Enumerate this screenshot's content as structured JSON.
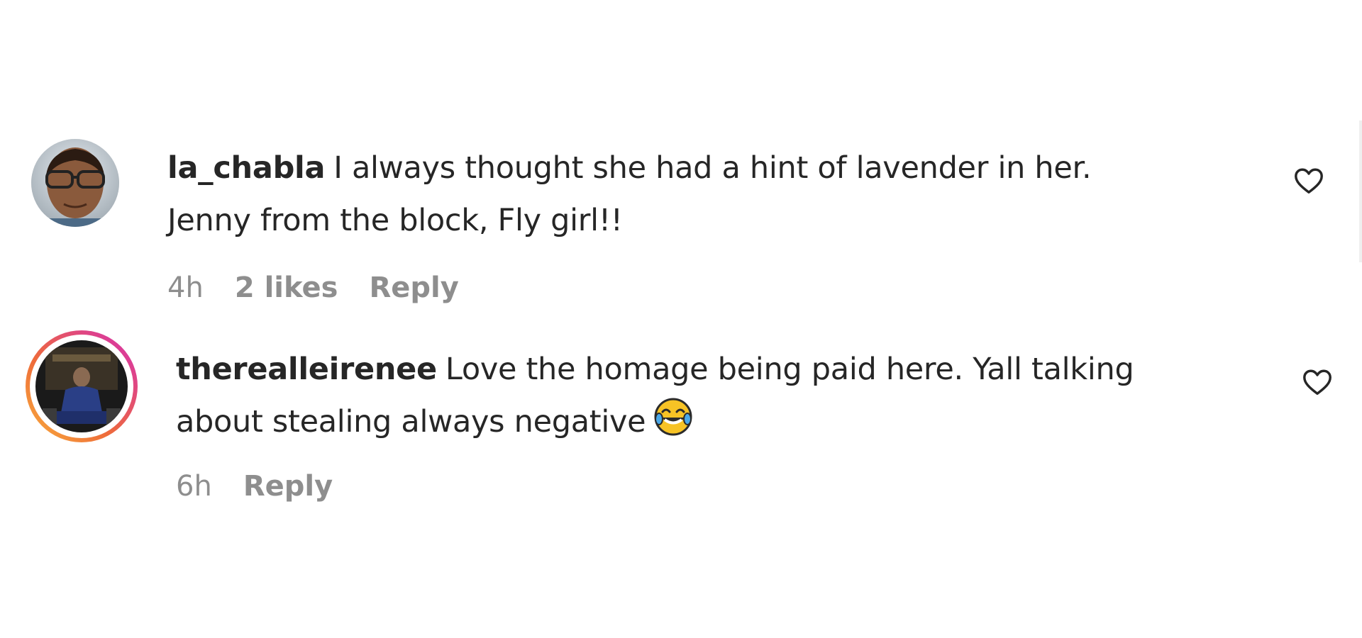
{
  "comments": [
    {
      "username": "la_chabla",
      "line1": "I always thought she had a hint of lavender in her.",
      "line2": "Jenny from the block, Fly girl!!",
      "time": "4h",
      "likes": "2 likes",
      "reply": "Reply",
      "avatar": "profile-photo",
      "has_story_ring": false
    },
    {
      "username": "therealleirenee",
      "line1": "Love the homage being paid here. Yall talking",
      "line2": "about stealing always negative",
      "line2_emoji": "face-with-tears-of-joy",
      "time": "6h",
      "reply": "Reply",
      "avatar": "profile-photo",
      "has_story_ring": true
    }
  ],
  "icons": {
    "like": "heart-outline-icon"
  },
  "colors": {
    "text": "#262626",
    "meta": "#8e8e8e",
    "story_ring_start": "#f9b13c",
    "story_ring_end": "#d52db6"
  }
}
